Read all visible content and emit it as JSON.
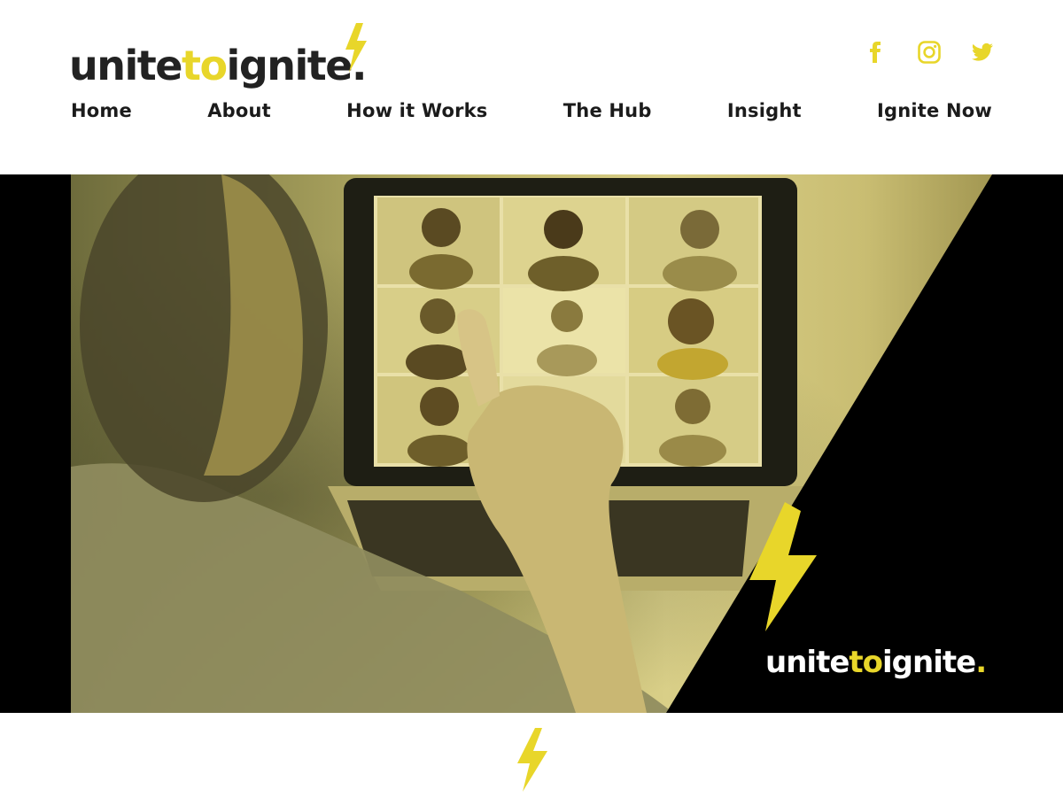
{
  "brand": {
    "logo_pre": "unite",
    "logo_mid": "to",
    "logo_post": "ignite",
    "logo_dot": ".",
    "accent_color": "#e8d62a",
    "dark_color": "#222222"
  },
  "social": [
    {
      "name": "facebook-icon"
    },
    {
      "name": "instagram-icon"
    },
    {
      "name": "twitter-icon"
    }
  ],
  "nav": {
    "items": [
      "Home",
      "About",
      "How it Works",
      "The Hub",
      "Insight",
      "Ignite Now"
    ]
  },
  "hero": {
    "brand_pre": "unite",
    "brand_mid": "to",
    "brand_post": "ignite",
    "brand_dot": "."
  }
}
